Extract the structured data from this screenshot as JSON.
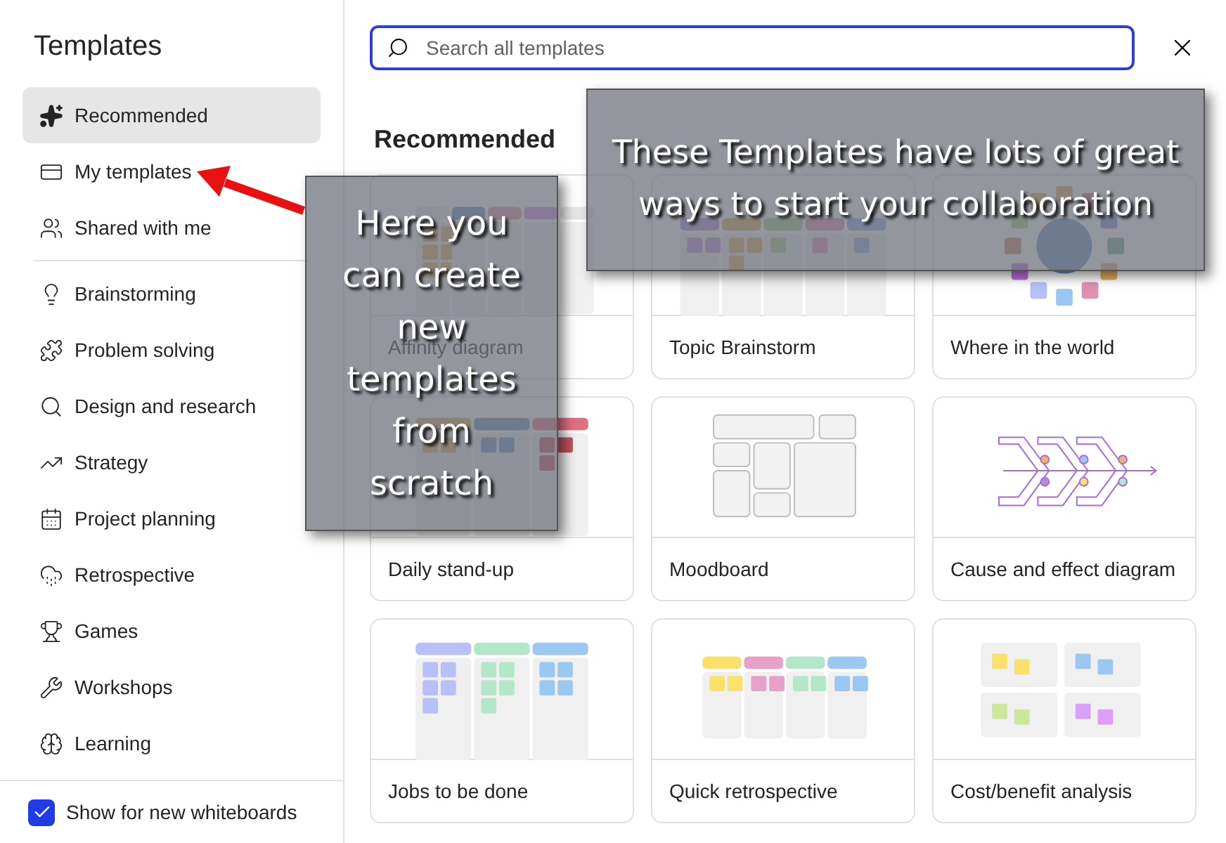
{
  "sidebar": {
    "title": "Templates",
    "primary_items": [
      {
        "label": "Recommended",
        "selected": true
      },
      {
        "label": "My templates",
        "selected": false
      },
      {
        "label": "Shared with me",
        "selected": false
      }
    ],
    "category_items": [
      {
        "label": "Brainstorming",
        "selected": false
      },
      {
        "label": "Problem solving",
        "selected": false
      },
      {
        "label": "Design and research",
        "selected": false
      },
      {
        "label": "Strategy",
        "selected": false
      },
      {
        "label": "Project planning",
        "selected": false
      },
      {
        "label": "Retrospective",
        "selected": false
      },
      {
        "label": "Games",
        "selected": false
      },
      {
        "label": "Workshops",
        "selected": false
      },
      {
        "label": "Learning",
        "selected": false
      }
    ],
    "show_for_new": {
      "label": "Show for new whiteboards",
      "checked": true
    }
  },
  "search": {
    "placeholder": "Search all templates"
  },
  "section_title": "Recommended",
  "templates": [
    {
      "title": "Affinity diagram",
      "kind": "affinity"
    },
    {
      "title": "Topic Brainstorm",
      "kind": "brainstorm"
    },
    {
      "title": "Where in the world",
      "kind": "world"
    },
    {
      "title": "Daily stand-up",
      "kind": "standup"
    },
    {
      "title": "Moodboard",
      "kind": "moodboard"
    },
    {
      "title": "Cause and effect diagram",
      "kind": "fishbone"
    },
    {
      "title": "Jobs to be done",
      "kind": "jobs"
    },
    {
      "title": "Quick retrospective",
      "kind": "retro"
    },
    {
      "title": "Cost/benefit analysis",
      "kind": "costbenefit"
    }
  ],
  "annotations": [
    {
      "text": "Here you can create new templates from scratch"
    },
    {
      "text": "These Templates have lots of great ways to start your collaboration"
    }
  ]
}
